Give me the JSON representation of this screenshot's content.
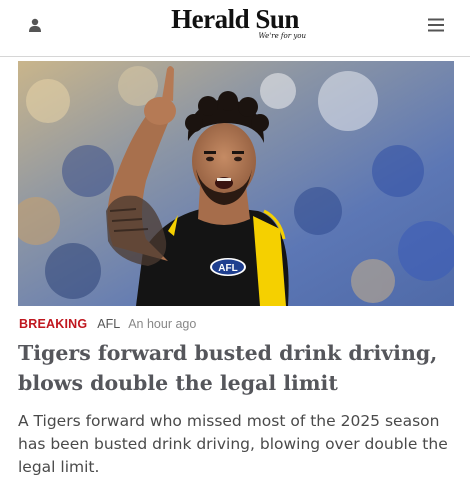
{
  "header": {
    "logo_name": "Herald Sun",
    "logo_tagline": "We're for you",
    "account_icon": "user-icon",
    "menu_icon": "hamburger-menu-icon"
  },
  "article": {
    "image_icon": "article-photo",
    "label": "BREAKING",
    "section": "AFL",
    "timestamp": "An hour ago",
    "headline": "Tigers forward busted drink driving, blows double the legal limit",
    "standfirst": "A Tigers forward who missed most of the 2025 season has been busted drink driving, blowing over double the legal limit.",
    "guernsey_logo": "AFL"
  },
  "colors": {
    "breaking": "#c0171f",
    "headline": "#55565b",
    "body_text": "#4a4a4a",
    "tigers_yellow": "#f5d000",
    "tigers_black": "#141414"
  }
}
